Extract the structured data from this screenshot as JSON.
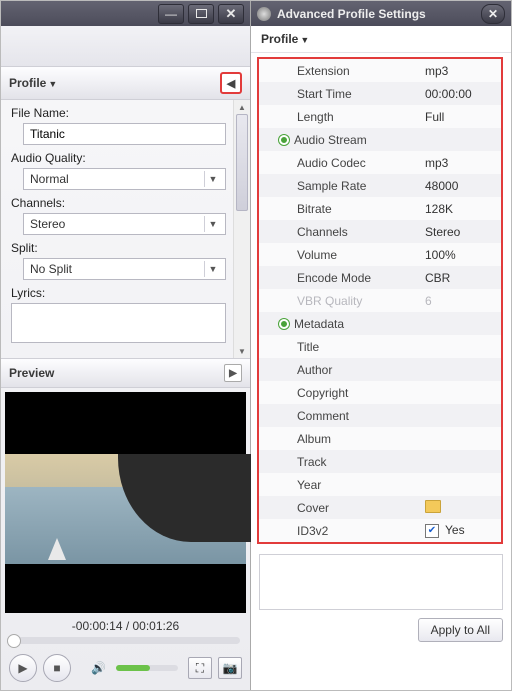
{
  "left": {
    "profile_header": "Profile",
    "filename_label": "File Name:",
    "filename_value": "Titanic",
    "audioquality_label": "Audio Quality:",
    "audioquality_value": "Normal",
    "channels_label": "Channels:",
    "channels_value": "Stereo",
    "split_label": "Split:",
    "split_value": "No Split",
    "lyrics_label": "Lyrics:",
    "lyrics_value": "",
    "preview_header": "Preview",
    "time_text": "-00:00:14 / 00:01:26"
  },
  "right": {
    "title": "Advanced Profile Settings",
    "sub": "Profile",
    "rows": {
      "extension_k": "Extension",
      "extension_v": "mp3",
      "start_k": "Start Time",
      "start_v": "00:00:00",
      "length_k": "Length",
      "length_v": "Full",
      "audio_group": "Audio Stream",
      "codec_k": "Audio Codec",
      "codec_v": "mp3",
      "rate_k": "Sample Rate",
      "rate_v": "48000",
      "bitrate_k": "Bitrate",
      "bitrate_v": "128K",
      "channels_k": "Channels",
      "channels_v": "Stereo",
      "volume_k": "Volume",
      "volume_v": "100%",
      "encode_k": "Encode Mode",
      "encode_v": "CBR",
      "vbr_k": "VBR Quality",
      "vbr_v": "6",
      "meta_group": "Metadata",
      "title_k": "Title",
      "title_v": "",
      "author_k": "Author",
      "author_v": "",
      "copyright_k": "Copyright",
      "copyright_v": "",
      "comment_k": "Comment",
      "comment_v": "",
      "album_k": "Album",
      "album_v": "",
      "track_k": "Track",
      "track_v": "",
      "year_k": "Year",
      "year_v": "",
      "cover_k": "Cover",
      "id3_k": "ID3v2",
      "id3_v": "Yes"
    },
    "apply": "Apply to All"
  }
}
